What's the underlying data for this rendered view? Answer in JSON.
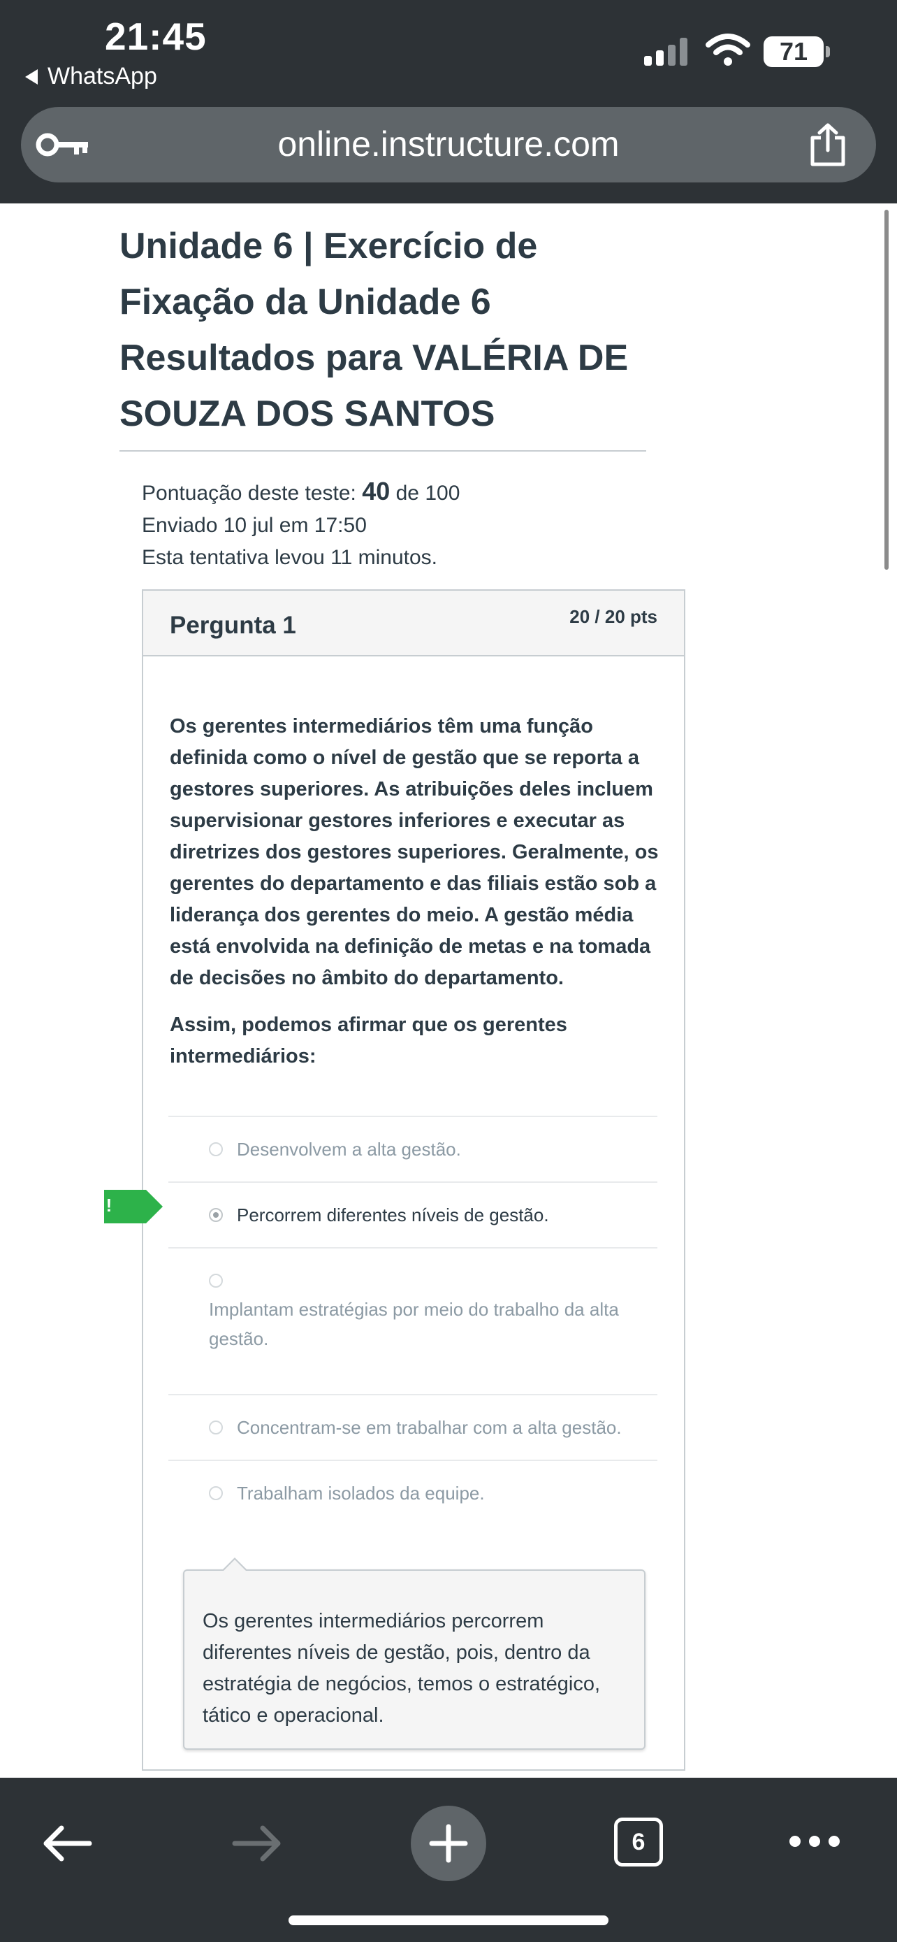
{
  "status_bar": {
    "time": "21:45",
    "back_app": "WhatsApp",
    "battery": "71"
  },
  "browser": {
    "url": "online.instructure.com"
  },
  "page": {
    "title_lines": [
      "Unidade 6 | Exercício de",
      "Fixação da Unidade 6",
      "Resultados para VALÉRIA DE",
      "SOUZA DOS SANTOS"
    ],
    "score_label": "Pontuação deste teste:",
    "score_value": "40",
    "score_suffix": "de 100",
    "submitted": "Enviado 10 jul em 17:50",
    "duration": "Esta tentativa levou 11 minutos."
  },
  "question": {
    "title": "Pergunta 1",
    "points": "20 / 20 pts",
    "text": "Os gerentes intermediários têm uma função definida como o nível de gestão que se reporta a gestores superiores. As atribuições deles incluem supervisionar gestores inferiores e executar as diretrizes dos gestores superiores. Geralmente, os gerentes do departamento e das filiais estão sob a liderança dos gerentes do meio. A gestão média está envolvida na definição de metas e na tomada de decisões no âmbito do departamento.",
    "prompt": "Assim, podemos afirmar que os gerentes intermediários:",
    "flag_mark": "!",
    "answers": [
      {
        "label": "Desenvolvem a alta gestão.",
        "selected": false
      },
      {
        "label": "Percorrem diferentes níveis de gestão.",
        "selected": true
      },
      {
        "label": "Implantam estratégias por meio do trabalho da alta gestão.",
        "selected": false
      },
      {
        "label": "Concentram-se em trabalhar com a alta gestão.",
        "selected": false
      },
      {
        "label": "Trabalham isolados da equipe.",
        "selected": false
      }
    ],
    "comment": "Os gerentes intermediários percorrem diferentes níveis de gestão, pois, dentro da estratégia de negócios, temos o estratégico, tático e operacional."
  },
  "toolbar": {
    "tab_count": "6"
  },
  "icons": [
    "back-arrow-icon",
    "forward-arrow-icon",
    "new-tab-plus-icon",
    "tabs-icon",
    "more-icon",
    "key-icon",
    "share-icon",
    "wifi-icon",
    "signal-icon",
    "battery-icon"
  ]
}
